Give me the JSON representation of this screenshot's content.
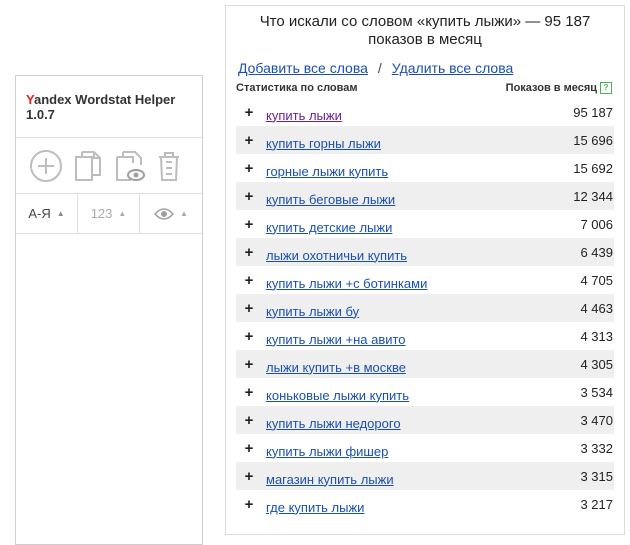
{
  "panel": {
    "title_first_letter": "Y",
    "title_rest": "andex Wordstat Helper",
    "version": "1.0.7",
    "sort": {
      "az_label": "А-Я",
      "num_label": "123",
      "arrow": "▲"
    }
  },
  "results": {
    "title": "Что искали со словом «купить лыжи» — 95 187 показов в месяц",
    "add_all": "Добавить все слова",
    "separator": "/",
    "remove_all": "Удалить все слова",
    "col_phrase": "Статистика по словам",
    "col_count": "Показов в месяц",
    "help_mark": "?",
    "plus": "+",
    "rows": [
      {
        "phrase": "купить лыжи",
        "count": "95 187"
      },
      {
        "phrase": "купить горны лыжи",
        "count": "15 696"
      },
      {
        "phrase": "горные лыжи купить",
        "count": "15 692"
      },
      {
        "phrase": "купить беговые лыжи",
        "count": "12 344"
      },
      {
        "phrase": "купить детские лыжи",
        "count": "7 006"
      },
      {
        "phrase": "лыжи охотничьи купить",
        "count": "6 439"
      },
      {
        "phrase": "купить лыжи +с ботинками",
        "count": "4 705"
      },
      {
        "phrase": "купить лыжи бу",
        "count": "4 463"
      },
      {
        "phrase": "купить лыжи +на авито",
        "count": "4 313"
      },
      {
        "phrase": "лыжи купить +в москве",
        "count": "4 305"
      },
      {
        "phrase": "коньковые лыжи купить",
        "count": "3 534"
      },
      {
        "phrase": "купить лыжи недорого",
        "count": "3 470"
      },
      {
        "phrase": "купить лыжи фишер",
        "count": "3 332"
      },
      {
        "phrase": "магазин купить лыжи",
        "count": "3 315"
      },
      {
        "phrase": "где купить лыжи",
        "count": "3 217"
      }
    ]
  },
  "colors": {
    "link": "#1a4fb0",
    "visited_link": "#6a1f91",
    "brand_red": "#e0261b",
    "stripe": "#efefef"
  }
}
